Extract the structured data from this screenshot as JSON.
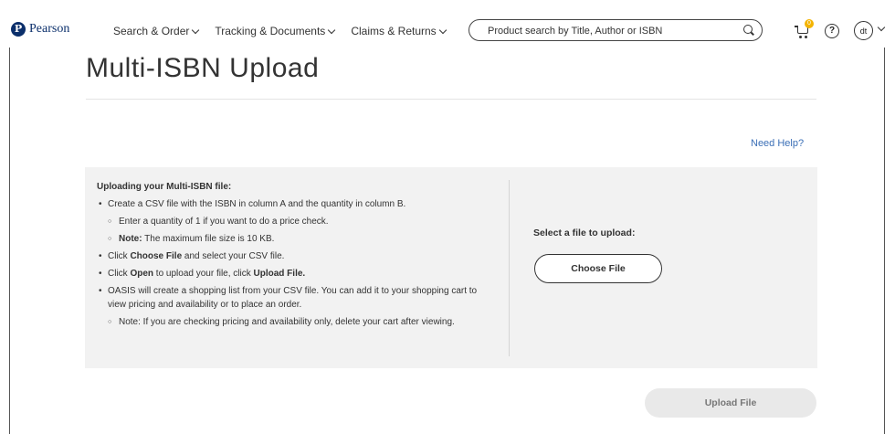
{
  "header": {
    "logo_text": "Pearson",
    "logo_mark": "P",
    "nav": [
      {
        "label": "Search & Order"
      },
      {
        "label": "Tracking & Documents"
      },
      {
        "label": "Claims & Returns"
      }
    ],
    "search": {
      "placeholder": "Product search by Title, Author or ISBN",
      "value": ""
    },
    "cart_badge": "0",
    "help_glyph": "?",
    "user_initials": "dt"
  },
  "page": {
    "title": "Multi-ISBN Upload",
    "need_help": "Need Help?"
  },
  "instructions": {
    "heading": "Uploading your Multi-ISBN file:",
    "b1": "Create a CSV file with the ISBN in column A and the quantity in column B.",
    "b1_sub1": "Enter a quantity of 1 if you want to do a price check.",
    "b1_sub2_bold": "Note:",
    "b1_sub2_text": " The maximum file size is 10 KB.",
    "b2_pre": "Click ",
    "b2_bold": "Choose File",
    "b2_post": " and select your CSV file.",
    "b3_pre": "Click ",
    "b3_bold1": "Open",
    "b3_mid": " to upload your file, click ",
    "b3_bold2": "Upload File.",
    "b4": "OASIS will create a shopping list from your CSV file. You can add it to your shopping cart to view pricing and availability or to place an order.",
    "b4_sub1": "Note: If you are checking pricing and availability only, delete your cart after viewing."
  },
  "upload": {
    "label": "Select a file to upload:",
    "choose_button": "Choose File",
    "upload_button": "Upload File"
  },
  "colors": {
    "brand": "#0b2f6b",
    "link": "#3b6fb6",
    "badge": "#f4b400",
    "panel_bg": "#f2f2f2"
  }
}
